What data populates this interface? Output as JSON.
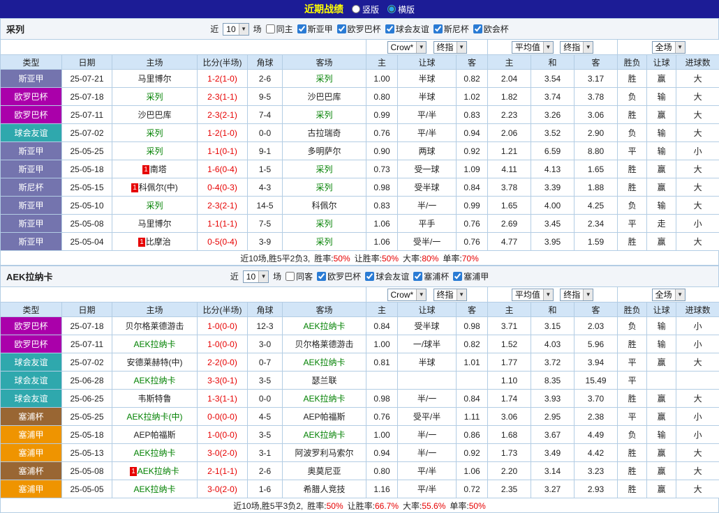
{
  "topbar": {
    "title": "近期战绩",
    "views": [
      {
        "label": "竖版",
        "selected": false
      },
      {
        "label": "横版",
        "selected": true
      }
    ]
  },
  "labels": {
    "near": "近",
    "games": "场"
  },
  "dropdowns": {
    "odds_source": "Crow*",
    "odds_stage": "终指",
    "avg_source": "平均值",
    "avg_stage": "终指",
    "scope": "全场"
  },
  "columns": [
    "类型",
    "日期",
    "主场",
    "比分(半场)",
    "角球",
    "客场",
    "主",
    "让球",
    "客",
    "主",
    "和",
    "客",
    "胜负",
    "让球",
    "进球数"
  ],
  "result_colors": {
    "胜": "red",
    "负": "blue",
    "平": "green",
    "赢": "red",
    "输": "blue",
    "走": "green",
    "大": "red",
    "小": "blue"
  },
  "league_colors": {
    "斯亚甲": "#7474ae",
    "欧罗巴杯": "#aa00aa",
    "球会友谊": "#2fa8ad",
    "斯尼杯": "#7474ae",
    "塞浦杯": "#996633",
    "塞浦甲": "#ef9400"
  },
  "sections": [
    {
      "team": "采列",
      "filter": {
        "count": "10",
        "same_label": "同主",
        "same_checked": false,
        "leagues": [
          {
            "label": "斯亚甲",
            "checked": true
          },
          {
            "label": "欧罗巴杯",
            "checked": true
          },
          {
            "label": "球会友谊",
            "checked": true
          },
          {
            "label": "斯尼杯",
            "checked": true
          },
          {
            "label": "欧会杯",
            "checked": true
          }
        ]
      },
      "rows": [
        {
          "league": "斯亚甲",
          "date": "25-07-21",
          "home": "马里博尔",
          "home_focus": false,
          "home_rank": "",
          "score": "1-2(1-0)",
          "corner": "2-6",
          "away": "采列",
          "away_focus": true,
          "away_rank": "",
          "odds": [
            "1.00",
            "半球",
            "0.82"
          ],
          "avg": [
            "2.04",
            "3.54",
            "3.17"
          ],
          "results": [
            "胜",
            "赢",
            "大"
          ]
        },
        {
          "league": "欧罗巴杯",
          "date": "25-07-18",
          "home": "采列",
          "home_focus": true,
          "home_rank": "",
          "score": "2-3(1-1)",
          "corner": "9-5",
          "away": "沙巴巴库",
          "away_focus": false,
          "away_rank": "",
          "odds": [
            "0.80",
            "半球",
            "1.02"
          ],
          "avg": [
            "1.82",
            "3.74",
            "3.78"
          ],
          "results": [
            "负",
            "输",
            "大"
          ]
        },
        {
          "league": "欧罗巴杯",
          "date": "25-07-11",
          "home": "沙巴巴库",
          "home_focus": false,
          "home_rank": "",
          "score": "2-3(2-1)",
          "corner": "7-4",
          "away": "采列",
          "away_focus": true,
          "away_rank": "",
          "odds": [
            "0.99",
            "平/半",
            "0.83"
          ],
          "avg": [
            "2.23",
            "3.26",
            "3.06"
          ],
          "results": [
            "胜",
            "赢",
            "大"
          ]
        },
        {
          "league": "球会友谊",
          "date": "25-07-02",
          "home": "采列",
          "home_focus": true,
          "home_rank": "",
          "score": "1-2(1-0)",
          "corner": "0-0",
          "away": "古拉瑞奇",
          "away_focus": false,
          "away_rank": "",
          "odds": [
            "0.76",
            "平/半",
            "0.94"
          ],
          "avg": [
            "2.06",
            "3.52",
            "2.90"
          ],
          "results": [
            "负",
            "输",
            "大"
          ]
        },
        {
          "league": "斯亚甲",
          "date": "25-05-25",
          "home": "采列",
          "home_focus": true,
          "home_rank": "",
          "score": "1-1(0-1)",
          "corner": "9-1",
          "away": "多明萨尔",
          "away_focus": false,
          "away_rank": "",
          "odds": [
            "0.90",
            "两球",
            "0.92"
          ],
          "avg": [
            "1.21",
            "6.59",
            "8.80"
          ],
          "results": [
            "平",
            "输",
            "小"
          ]
        },
        {
          "league": "斯亚甲",
          "date": "25-05-18",
          "home": "南塔",
          "home_focus": false,
          "home_rank": "1",
          "score": "1-6(0-4)",
          "corner": "1-5",
          "away": "采列",
          "away_focus": true,
          "away_rank": "",
          "odds": [
            "0.73",
            "受一球",
            "1.09"
          ],
          "avg": [
            "4.11",
            "4.13",
            "1.65"
          ],
          "results": [
            "胜",
            "赢",
            "大"
          ]
        },
        {
          "league": "斯尼杯",
          "date": "25-05-15",
          "home": "科佩尔(中)",
          "home_focus": false,
          "home_rank": "1",
          "score": "0-4(0-3)",
          "corner": "4-3",
          "away": "采列",
          "away_focus": true,
          "away_rank": "",
          "odds": [
            "0.98",
            "受半球",
            "0.84"
          ],
          "avg": [
            "3.78",
            "3.39",
            "1.88"
          ],
          "results": [
            "胜",
            "赢",
            "大"
          ]
        },
        {
          "league": "斯亚甲",
          "date": "25-05-10",
          "home": "采列",
          "home_focus": true,
          "home_rank": "",
          "score": "2-3(2-1)",
          "corner": "14-5",
          "away": "科佩尔",
          "away_focus": false,
          "away_rank": "",
          "odds": [
            "0.83",
            "半/一",
            "0.99"
          ],
          "avg": [
            "1.65",
            "4.00",
            "4.25"
          ],
          "results": [
            "负",
            "输",
            "大"
          ]
        },
        {
          "league": "斯亚甲",
          "date": "25-05-08",
          "home": "马里博尔",
          "home_focus": false,
          "home_rank": "",
          "score": "1-1(1-1)",
          "corner": "7-5",
          "away": "采列",
          "away_focus": true,
          "away_rank": "",
          "odds": [
            "1.06",
            "平手",
            "0.76"
          ],
          "avg": [
            "2.69",
            "3.45",
            "2.34"
          ],
          "results": [
            "平",
            "走",
            "小"
          ]
        },
        {
          "league": "斯亚甲",
          "date": "25-05-04",
          "home": "比摩治",
          "home_focus": false,
          "home_rank": "1",
          "score": "0-5(0-4)",
          "corner": "3-9",
          "away": "采列",
          "away_focus": true,
          "away_rank": "",
          "odds": [
            "1.06",
            "受半/一",
            "0.76"
          ],
          "avg": [
            "4.77",
            "3.95",
            "1.59"
          ],
          "results": [
            "胜",
            "赢",
            "大"
          ]
        }
      ],
      "footer": {
        "prefix": "近10场,胜5平2负3,",
        "stats": [
          {
            "label": "胜率:",
            "value": "50%"
          },
          {
            "label": "让胜率:",
            "value": "50%"
          },
          {
            "label": "大率:",
            "value": "80%"
          },
          {
            "label": "单率:",
            "value": "70%"
          }
        ]
      }
    },
    {
      "team": "AEK拉纳卡",
      "filter": {
        "count": "10",
        "same_label": "同客",
        "same_checked": false,
        "leagues": [
          {
            "label": "欧罗巴杯",
            "checked": true
          },
          {
            "label": "球会友谊",
            "checked": true
          },
          {
            "label": "塞浦杯",
            "checked": true
          },
          {
            "label": "塞浦甲",
            "checked": true
          }
        ]
      },
      "rows": [
        {
          "league": "欧罗巴杯",
          "date": "25-07-18",
          "home": "贝尔格莱德游击",
          "home_focus": false,
          "home_rank": "",
          "score": "1-0(0-0)",
          "corner": "12-3",
          "away": "AEK拉纳卡",
          "away_focus": true,
          "away_rank": "",
          "odds": [
            "0.84",
            "受半球",
            "0.98"
          ],
          "avg": [
            "3.71",
            "3.15",
            "2.03"
          ],
          "results": [
            "负",
            "输",
            "小"
          ]
        },
        {
          "league": "欧罗巴杯",
          "date": "25-07-11",
          "home": "AEK拉纳卡",
          "home_focus": true,
          "home_rank": "",
          "score": "1-0(0-0)",
          "corner": "3-0",
          "away": "贝尔格莱德游击",
          "away_focus": false,
          "away_rank": "",
          "odds": [
            "1.00",
            "一/球半",
            "0.82"
          ],
          "avg": [
            "1.52",
            "4.03",
            "5.96"
          ],
          "results": [
            "胜",
            "输",
            "小"
          ]
        },
        {
          "league": "球会友谊",
          "date": "25-07-02",
          "home": "安德莱赫特(中)",
          "home_focus": false,
          "home_rank": "",
          "score": "2-2(0-0)",
          "corner": "0-7",
          "away": "AEK拉纳卡",
          "away_focus": true,
          "away_rank": "",
          "odds": [
            "0.81",
            "半球",
            "1.01"
          ],
          "avg": [
            "1.77",
            "3.72",
            "3.94"
          ],
          "results": [
            "平",
            "赢",
            "大"
          ]
        },
        {
          "league": "球会友谊",
          "date": "25-06-28",
          "home": "AEK拉纳卡",
          "home_focus": true,
          "home_rank": "",
          "score": "3-3(0-1)",
          "corner": "3-5",
          "away": "瑟兰联",
          "away_focus": false,
          "away_rank": "",
          "odds": [
            "",
            "",
            ""
          ],
          "avg": [
            "1.10",
            "8.35",
            "15.49"
          ],
          "results": [
            "平",
            "",
            ""
          ]
        },
        {
          "league": "球会友谊",
          "date": "25-06-25",
          "home": "韦斯特鲁",
          "home_focus": false,
          "home_rank": "",
          "score": "1-3(1-1)",
          "corner": "0-0",
          "away": "AEK拉纳卡",
          "away_focus": true,
          "away_rank": "",
          "odds": [
            "0.98",
            "半/一",
            "0.84"
          ],
          "avg": [
            "1.74",
            "3.93",
            "3.70"
          ],
          "results": [
            "胜",
            "赢",
            "大"
          ]
        },
        {
          "league": "塞浦杯",
          "date": "25-05-25",
          "home": "AEK拉纳卡(中)",
          "home_focus": true,
          "home_rank": "",
          "score": "0-0(0-0)",
          "corner": "4-5",
          "away": "AEP帕福斯",
          "away_focus": false,
          "away_rank": "",
          "odds": [
            "0.76",
            "受平/半",
            "1.11"
          ],
          "avg": [
            "3.06",
            "2.95",
            "2.38"
          ],
          "results": [
            "平",
            "赢",
            "小"
          ]
        },
        {
          "league": "塞浦甲",
          "date": "25-05-18",
          "home": "AEP帕福斯",
          "home_focus": false,
          "home_rank": "",
          "score": "1-0(0-0)",
          "corner": "3-5",
          "away": "AEK拉纳卡",
          "away_focus": true,
          "away_rank": "",
          "odds": [
            "1.00",
            "半/一",
            "0.86"
          ],
          "avg": [
            "1.68",
            "3.67",
            "4.49"
          ],
          "results": [
            "负",
            "输",
            "小"
          ]
        },
        {
          "league": "塞浦甲",
          "date": "25-05-13",
          "home": "AEK拉纳卡",
          "home_focus": true,
          "home_rank": "",
          "score": "3-0(2-0)",
          "corner": "3-1",
          "away": "阿波罗利马索尔",
          "away_focus": false,
          "away_rank": "",
          "odds": [
            "0.94",
            "半/一",
            "0.92"
          ],
          "avg": [
            "1.73",
            "3.49",
            "4.42"
          ],
          "results": [
            "胜",
            "赢",
            "大"
          ]
        },
        {
          "league": "塞浦杯",
          "date": "25-05-08",
          "home": "AEK拉纳卡",
          "home_focus": true,
          "home_rank": "1",
          "score": "2-1(1-1)",
          "corner": "2-6",
          "away": "奥莫尼亚",
          "away_focus": false,
          "away_rank": "",
          "odds": [
            "0.80",
            "平/半",
            "1.06"
          ],
          "avg": [
            "2.20",
            "3.14",
            "3.23"
          ],
          "results": [
            "胜",
            "赢",
            "大"
          ]
        },
        {
          "league": "塞浦甲",
          "date": "25-05-05",
          "home": "AEK拉纳卡",
          "home_focus": true,
          "home_rank": "",
          "score": "3-0(2-0)",
          "corner": "1-6",
          "away": "希腊人竞技",
          "away_focus": false,
          "away_rank": "",
          "odds": [
            "1.16",
            "平/半",
            "0.72"
          ],
          "avg": [
            "2.35",
            "3.27",
            "2.93"
          ],
          "results": [
            "胜",
            "赢",
            "大"
          ]
        }
      ],
      "footer": {
        "prefix": "近10场,胜5平3负2,",
        "stats": [
          {
            "label": "胜率:",
            "value": "50%"
          },
          {
            "label": "让胜率:",
            "value": "66.7%"
          },
          {
            "label": "大率:",
            "value": "55.6%"
          },
          {
            "label": "单率:",
            "value": "50%"
          }
        ]
      }
    }
  ]
}
